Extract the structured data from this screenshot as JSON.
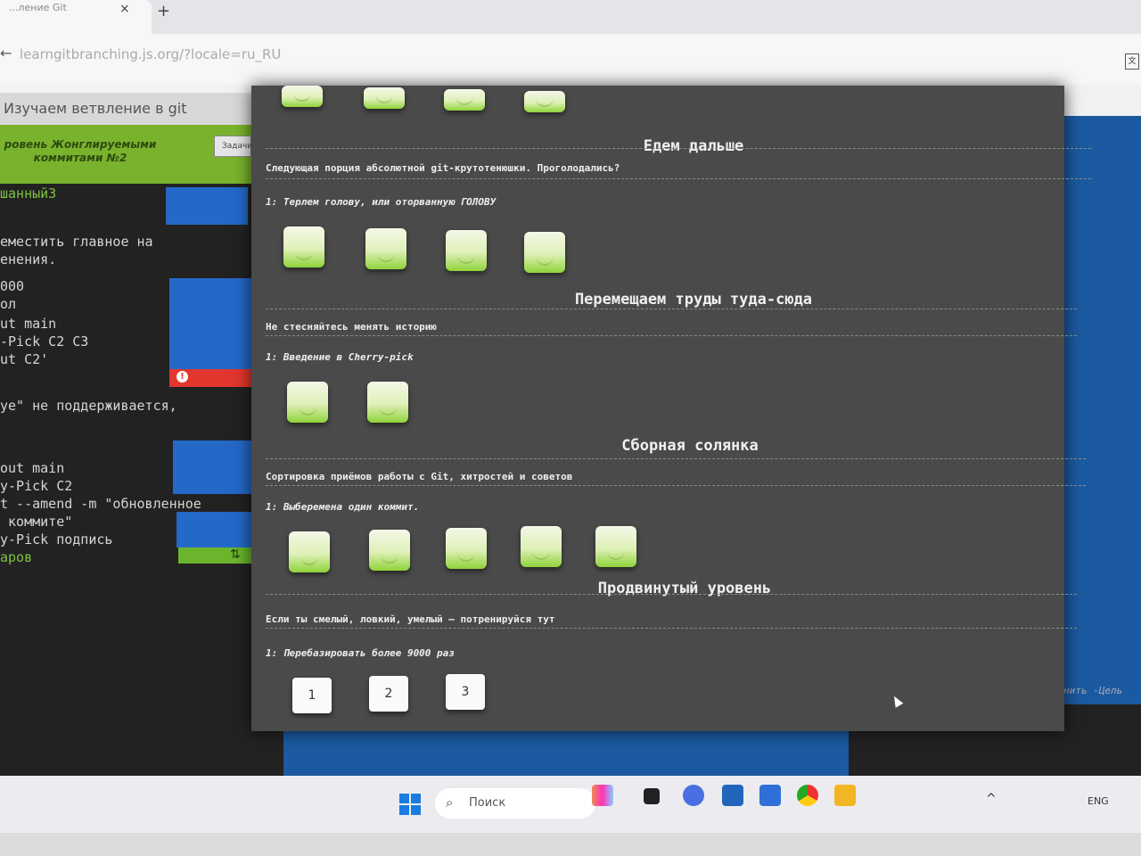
{
  "browser": {
    "tab_title": "...ление Git",
    "tab_close": "×",
    "new_tab": "+",
    "url": "learngitbranching.js.org/?locale=ru_RU",
    "back": "←"
  },
  "app": {
    "title": "Изучаем ветвление в git",
    "level_label": "ровень Жонглируемыми коммитами №2",
    "task_button": "Задачи",
    "terminal_lines": [
      {
        "text": "шанный3",
        "color": "green"
      },
      {
        "text": "еместить главное на",
        "color": "normal"
      },
      {
        "text": "енения.",
        "color": "normal"
      },
      {
        "text": "000",
        "color": "normal"
      },
      {
        "text": "ол",
        "color": "normal"
      },
      {
        "text": "ut main",
        "color": "normal"
      },
      {
        "text": "-Pick C2 C3",
        "color": "normal"
      },
      {
        "text": "ut C2'",
        "color": "normal"
      },
      {
        "text": "ye\" не поддерживается,",
        "color": "normal"
      },
      {
        "text": "out main",
        "color": "normal"
      },
      {
        "text": "y-Pick C2",
        "color": "normal"
      },
      {
        "text": "t --amend -m \"обновленное",
        "color": "normal"
      },
      {
        "text": " коммите\"",
        "color": "normal"
      },
      {
        "text": "y-Pick подпись",
        "color": "normal"
      },
      {
        "text": "аров",
        "color": "green"
      }
    ],
    "warn_symbol": "!",
    "sync_symbol": "⇅",
    "right_hint": "нить  -Цель"
  },
  "modal": {
    "sections": [
      {
        "title": "Едем дальше",
        "about": "Следующая порция абсолютной git-крутотенюшки. Проголодались?",
        "level": "1: Терлем голову, или оторванную ГОЛОВУ",
        "buttons": 4
      },
      {
        "title": "Перемещаем труды туда-сюда",
        "about": "Не стесняйтесь менять историю",
        "level": "1: Введение в Cherry-pick",
        "buttons": 2
      },
      {
        "title": "Сборная солянка",
        "about": "Сортировка приёмов работы с Git, хитростей и советов",
        "level": "1: Выберемена один коммит.",
        "buttons": 5
      },
      {
        "title": "Продвинутый уровень",
        "about": "Если ты смелый, ловкий, умелый – потренируйся тут",
        "level": "1: Перебазировать более 9000 раз",
        "number_buttons": [
          "1",
          "2",
          "3"
        ]
      }
    ]
  },
  "taskbar": {
    "search_placeholder": "Поиск",
    "search_icon": "⌕",
    "language": "ENG",
    "tray_up": "^"
  },
  "colors": {
    "level_green": "#79b32d",
    "command_blue": "#2468c8",
    "error_red": "#e2362e",
    "modal_bg": "#4a4a4a"
  }
}
